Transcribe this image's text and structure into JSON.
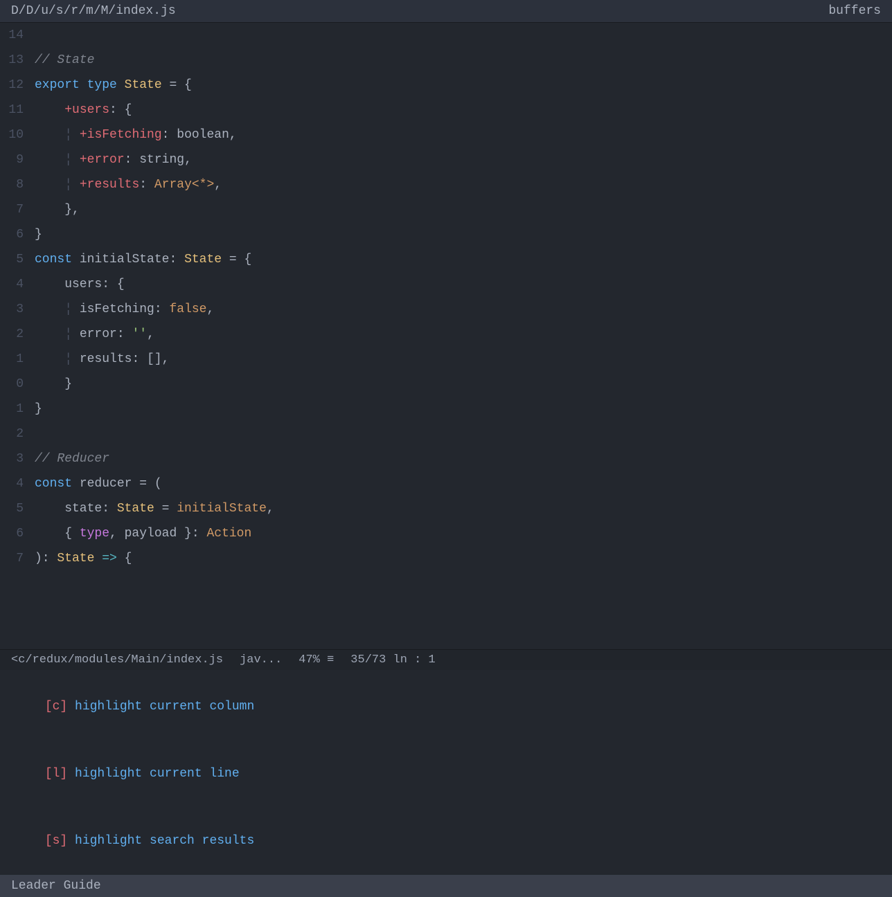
{
  "titleBar": {
    "filename": "D/D/u/s/r/m/M/index.js",
    "buffersLabel": "buffers"
  },
  "codeLines": [
    {
      "num": "14",
      "content": ""
    },
    {
      "num": "13",
      "type": "comment",
      "content": "// State"
    },
    {
      "num": "12",
      "type": "code",
      "content": "export type State = {"
    },
    {
      "num": "11",
      "type": "code",
      "content": "  +users: {"
    },
    {
      "num": "10",
      "type": "code",
      "content": "    +isFetching: boolean,"
    },
    {
      "num": "9",
      "type": "code",
      "content": "    +error: string,"
    },
    {
      "num": "8",
      "type": "code",
      "content": "    +results: Array<*>,"
    },
    {
      "num": "7",
      "type": "code",
      "content": "  },"
    },
    {
      "num": "6",
      "type": "code",
      "content": "}"
    },
    {
      "num": "5",
      "type": "code",
      "content": "const initialState: State = {"
    },
    {
      "num": "4",
      "type": "code",
      "content": "  users: {"
    },
    {
      "num": "3",
      "type": "code",
      "content": "    isFetching: false,"
    },
    {
      "num": "2",
      "type": "code",
      "content": "    error: '',"
    },
    {
      "num": "1",
      "type": "code",
      "content": "    results: [],"
    },
    {
      "num": "0",
      "type": "code",
      "content": "  }"
    },
    {
      "num": "1",
      "type": "code",
      "content": "}"
    },
    {
      "num": "2",
      "type": "blank",
      "content": ""
    },
    {
      "num": "3",
      "type": "comment",
      "content": "// Reducer"
    },
    {
      "num": "4",
      "type": "code",
      "content": "const reducer = ("
    },
    {
      "num": "5",
      "type": "code",
      "content": "  state: State = initialState,"
    },
    {
      "num": "6",
      "type": "code",
      "content": "  { type, payload }: Action"
    },
    {
      "num": "7",
      "type": "code",
      "content": "): State => {"
    }
  ],
  "statusBar": {
    "filepath": "<c/redux/modules/Main/index.js",
    "language": "jav...",
    "percent": "47%",
    "icon": "≡",
    "position": "35/73",
    "ln": "ln :",
    "col": "1"
  },
  "hints": [
    {
      "key": "[c]",
      "text": " highlight current column"
    },
    {
      "key": "[l]",
      "text": " highlight current line"
    },
    {
      "key": "[s]",
      "text": " highlight search results"
    }
  ],
  "leaderGuide": "Leader Guide"
}
